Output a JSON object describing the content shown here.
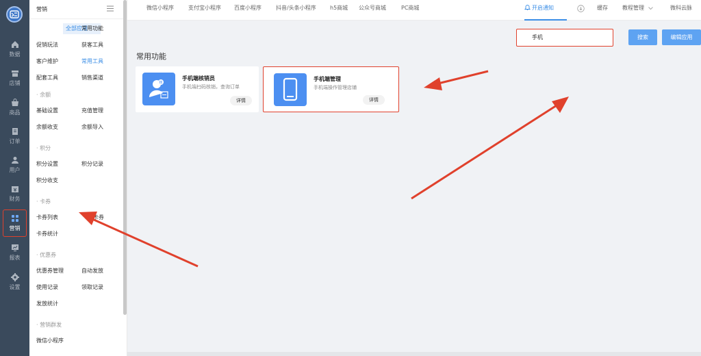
{
  "rail": {
    "items": [
      {
        "label": "数据",
        "icon": "home-icon"
      },
      {
        "label": "店铺",
        "icon": "store-icon"
      },
      {
        "label": "商品",
        "icon": "bag-icon"
      },
      {
        "label": "订单",
        "icon": "order-icon"
      },
      {
        "label": "用户",
        "icon": "user-icon"
      },
      {
        "label": "财务",
        "icon": "finance-icon"
      },
      {
        "label": "营销",
        "icon": "grid-icon",
        "active": true
      },
      {
        "label": "报表",
        "icon": "report-icon"
      },
      {
        "label": "设置",
        "icon": "gear-icon"
      }
    ]
  },
  "submenu": {
    "title": "营销",
    "rows": [
      {
        "left": "全部应用",
        "right": "常用功能"
      },
      {
        "left": "促销玩法",
        "right": "获客工具"
      },
      {
        "left": "客户维护",
        "right": "常用工具"
      },
      {
        "left": "配套工具",
        "right": "销售渠道"
      }
    ],
    "sections": {
      "balance": {
        "title": "· 余额",
        "items": [
          "基础设置",
          "充值管理",
          "余额收支",
          "余额导入"
        ]
      },
      "points": {
        "title": "· 积分",
        "items": [
          "积分设置",
          "积分记录",
          "积分收支"
        ]
      },
      "coupon_card": {
        "title": "· 卡券",
        "items": [
          "卡券列表",
          "卡券",
          "卡券统计"
        ]
      },
      "coupons": {
        "title": "· 优惠券",
        "items": [
          "优惠券管理",
          "自动发放",
          "使用记录",
          "领取记录",
          "发放统计"
        ]
      },
      "broadcast": {
        "title": "· 营销群发",
        "items": [
          "微信小程序"
        ]
      }
    }
  },
  "topbar": {
    "tabs": [
      "微信小程序",
      "支付宝小程序",
      "百度小程序",
      "抖音/头条小程序",
      "h5商城",
      "公众号商城",
      "PC商城"
    ],
    "notify": "开启通知",
    "cache": "缓存",
    "tutorial": "教程管理",
    "brand": "微科云脉"
  },
  "search": {
    "value": "手机",
    "button": "搜索",
    "edit_button": "编辑应用"
  },
  "section_title": "常用功能",
  "cards": [
    {
      "name": "手机端核销员",
      "desc": "手机端扫码核销，查询订单",
      "detail": "详情",
      "icon": "verify-user-icon"
    },
    {
      "name": "手机端管理",
      "desc": "手机端操作管理店铺",
      "detail": "详情",
      "icon": "phone-icon"
    }
  ],
  "colors": {
    "rail_bg": "#3a4a5c",
    "accent": "#3b8ee6",
    "button": "#5ea3f2",
    "highlight_red": "#e0412c",
    "app_icon": "#4c8ff1"
  }
}
